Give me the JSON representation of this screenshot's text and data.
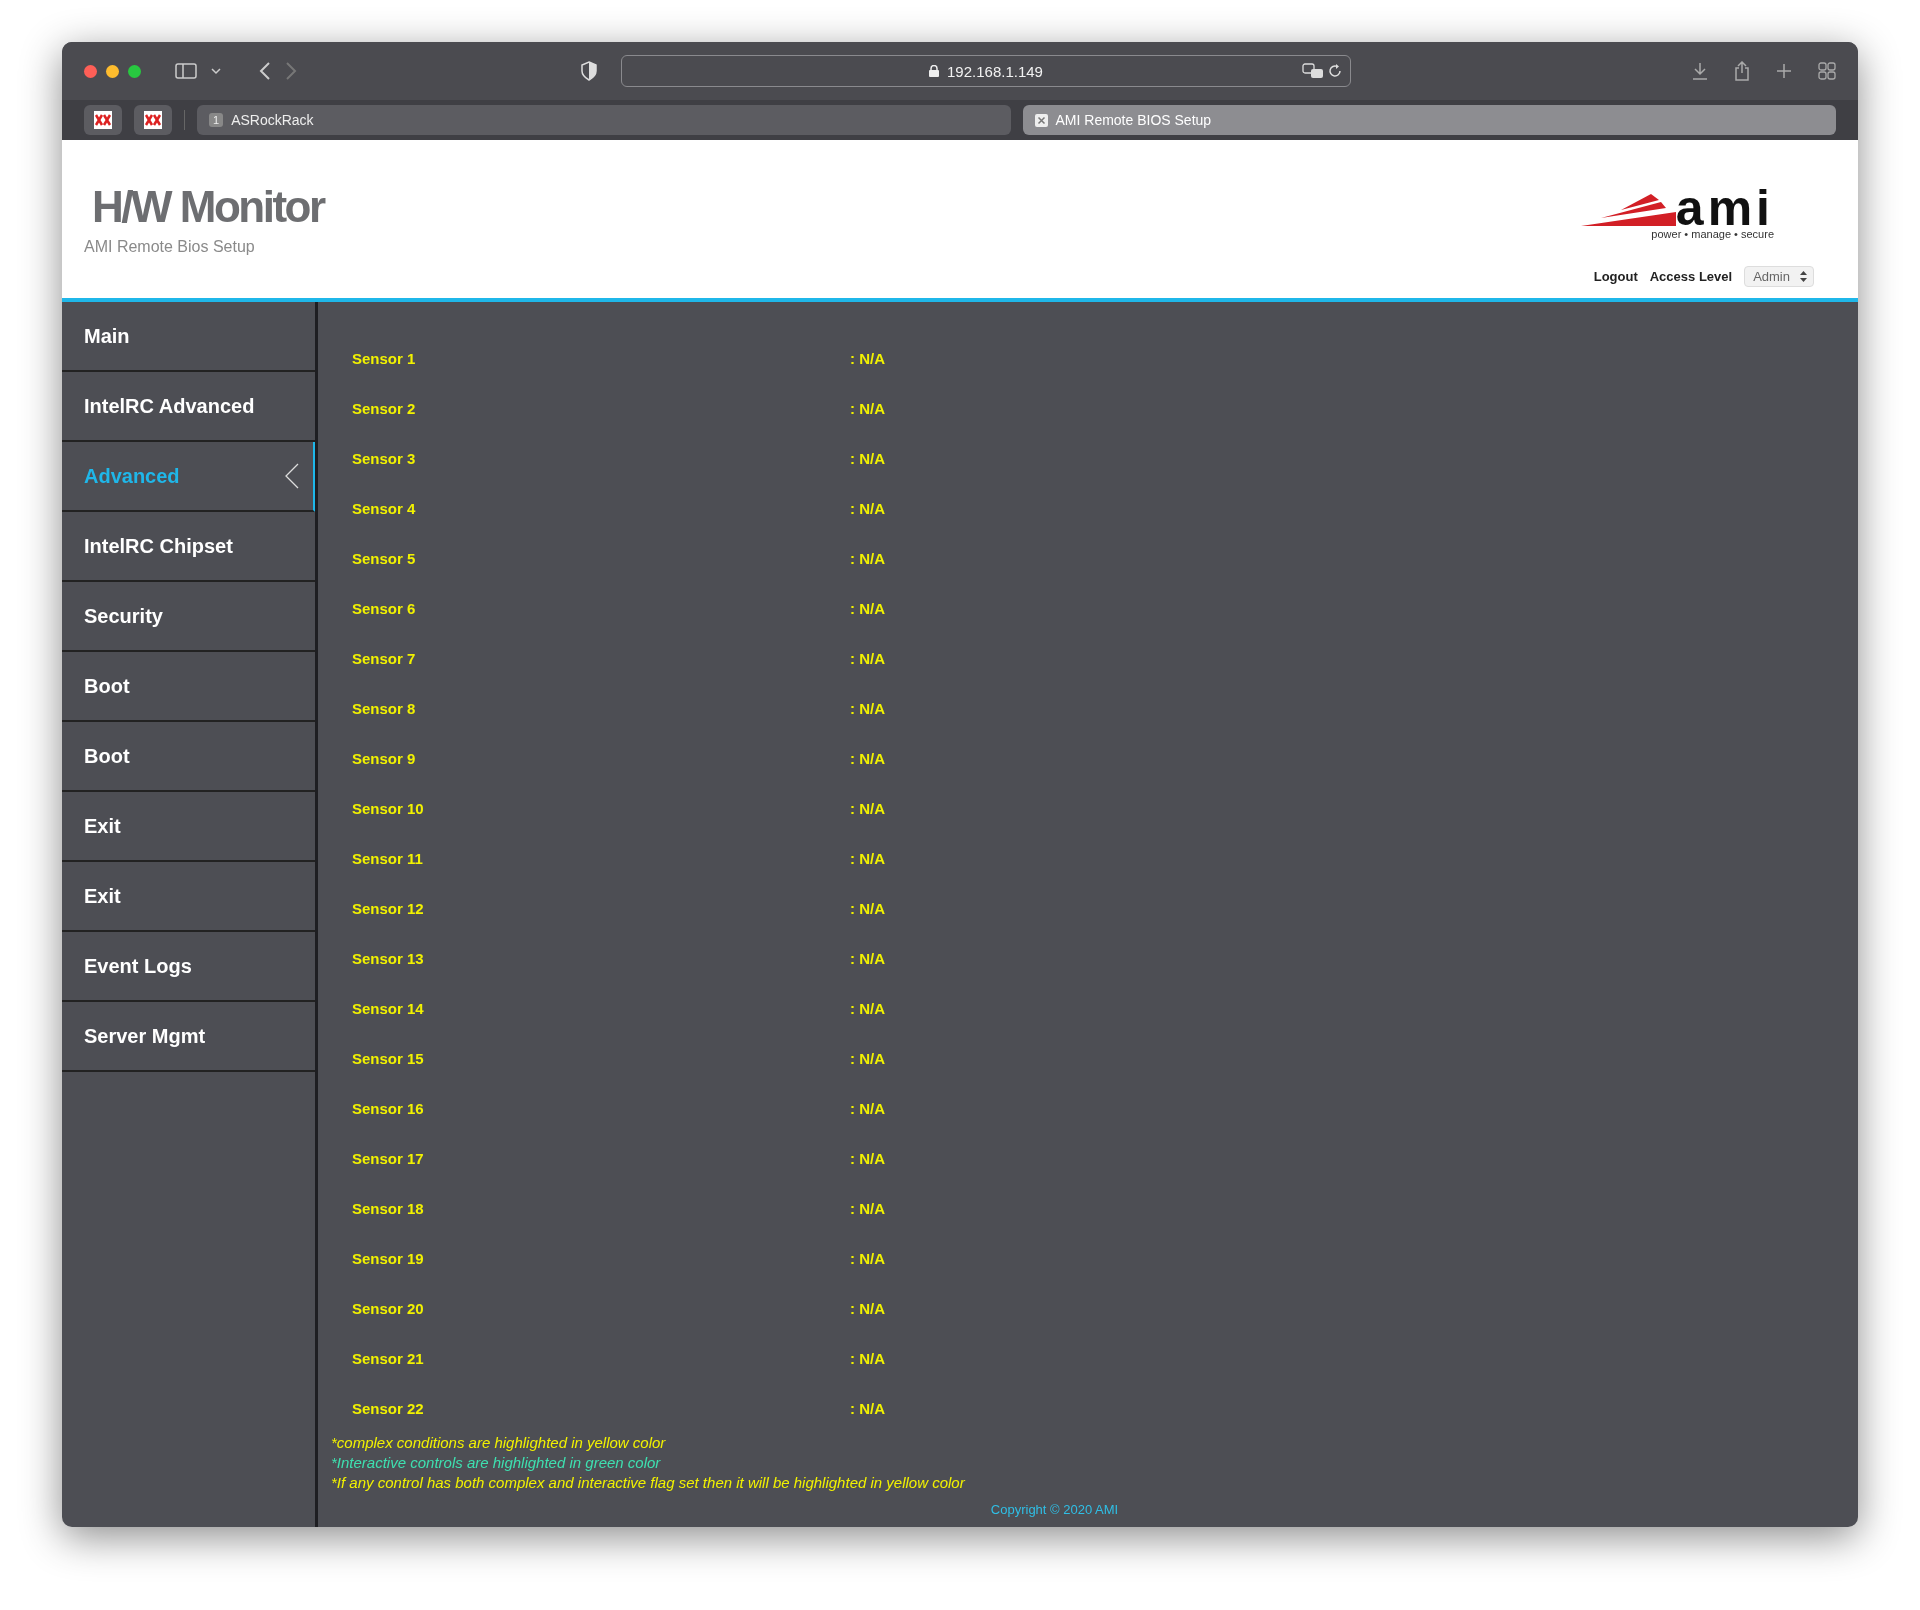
{
  "browser": {
    "url": "192.168.1.149",
    "tabs": [
      {
        "label": "ASRockRack",
        "badge": "1",
        "selected": false
      },
      {
        "label": "AMI Remote BIOS Setup",
        "selected": true
      }
    ]
  },
  "header": {
    "title": "H/W Monitor",
    "subtitle": "AMI Remote Bios Setup",
    "logo_text": "ami",
    "logo_tagline": "power • manage • secure",
    "logout": "Logout",
    "access_label": "Access Level",
    "access_value": "Admin"
  },
  "sidebar": {
    "items": [
      {
        "label": "Main",
        "selected": false
      },
      {
        "label": "IntelRC Advanced",
        "selected": false
      },
      {
        "label": "Advanced",
        "selected": true
      },
      {
        "label": "IntelRC Chipset",
        "selected": false
      },
      {
        "label": "Security",
        "selected": false
      },
      {
        "label": "Boot",
        "selected": false
      },
      {
        "label": "Boot",
        "selected": false
      },
      {
        "label": "Exit",
        "selected": false
      },
      {
        "label": "Exit",
        "selected": false
      },
      {
        "label": "Event Logs",
        "selected": false
      },
      {
        "label": "Server Mgmt",
        "selected": false
      }
    ]
  },
  "sensors": [
    {
      "label": "Sensor 1",
      "value": ": N/A"
    },
    {
      "label": "Sensor 2",
      "value": ": N/A"
    },
    {
      "label": "Sensor 3",
      "value": ": N/A"
    },
    {
      "label": "Sensor 4",
      "value": ": N/A"
    },
    {
      "label": "Sensor 5",
      "value": ": N/A"
    },
    {
      "label": "Sensor 6",
      "value": ": N/A"
    },
    {
      "label": "Sensor 7",
      "value": ": N/A"
    },
    {
      "label": "Sensor 8",
      "value": ": N/A"
    },
    {
      "label": "Sensor 9",
      "value": ": N/A"
    },
    {
      "label": "Sensor 10",
      "value": ": N/A"
    },
    {
      "label": "Sensor 11",
      "value": ": N/A"
    },
    {
      "label": "Sensor 12",
      "value": ": N/A"
    },
    {
      "label": "Sensor 13",
      "value": ": N/A"
    },
    {
      "label": "Sensor 14",
      "value": ": N/A"
    },
    {
      "label": "Sensor 15",
      "value": ": N/A"
    },
    {
      "label": "Sensor 16",
      "value": ": N/A"
    },
    {
      "label": "Sensor 17",
      "value": ": N/A"
    },
    {
      "label": "Sensor 18",
      "value": ": N/A"
    },
    {
      "label": "Sensor 19",
      "value": ": N/A"
    },
    {
      "label": "Sensor 20",
      "value": ": N/A"
    },
    {
      "label": "Sensor 21",
      "value": ": N/A"
    },
    {
      "label": "Sensor 22",
      "value": ": N/A"
    }
  ],
  "notes": [
    {
      "text": "*complex conditions are highlighted in yellow color",
      "color": "#f2f200"
    },
    {
      "text": "*Interactive controls are highlighted in green color",
      "color": "#3ee0b0"
    },
    {
      "text": "*If any control has both complex and interactive flag set then it will be highlighted in yellow color",
      "color": "#f2f200"
    }
  ],
  "copyright": "Copyright © 2020 AMI"
}
